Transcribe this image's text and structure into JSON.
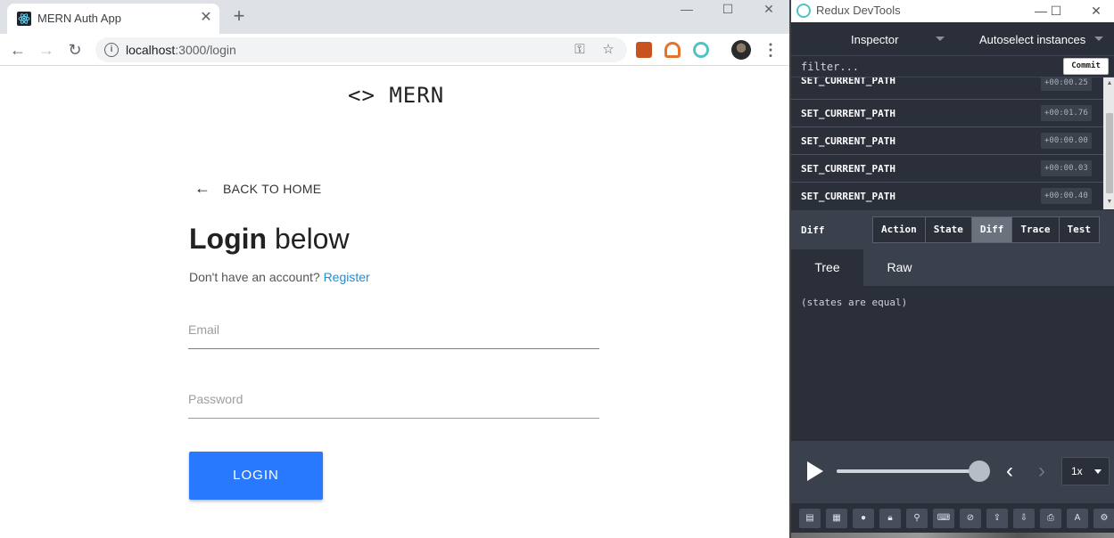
{
  "browser": {
    "tab_title": "MERN Auth App",
    "url_host": "localhost",
    "url_rest": ":3000/login",
    "window_controls": [
      "minimize-icon",
      "maximize-icon",
      "close-icon"
    ]
  },
  "page": {
    "brand": "<> MERN",
    "back_label": "BACK TO HOME",
    "heading_bold": "Login",
    "heading_rest": "below",
    "subtitle": "Don't have an account?",
    "register_link": "Register",
    "email_label": "Email",
    "password_label": "Password",
    "login_button": "LOGIN",
    "colors": {
      "primary_button": "#2979ff",
      "link": "#1f8fd6",
      "field_focus": "#26a69a"
    }
  },
  "devtools": {
    "window_title": "Redux DevTools",
    "monitor": "Inspector",
    "instance_select": "Autoselect instances",
    "filter_placeholder": "filter...",
    "commit_label": "Commit",
    "actions": [
      {
        "name": "SET_CURRENT_PATH",
        "time": "+00:00.25"
      },
      {
        "name": "SET_CURRENT_PATH",
        "time": "+00:01.76"
      },
      {
        "name": "SET_CURRENT_PATH",
        "time": "+00:00.00"
      },
      {
        "name": "SET_CURRENT_PATH",
        "time": "+00:00.03"
      },
      {
        "name": "SET_CURRENT_PATH",
        "time": "+00:00.40"
      }
    ],
    "panel_label": "Diff",
    "tabs": [
      "Action",
      "State",
      "Diff",
      "Trace",
      "Test"
    ],
    "active_tab": "Diff",
    "subtabs": [
      "Tree",
      "Raw"
    ],
    "active_subtab": "Tree",
    "diff_message": "(states are equal)",
    "slider_position": 1.0,
    "speed": "1x",
    "footer_icons": [
      "dock-left-icon",
      "dock-right-icon",
      "record-icon",
      "lock-icon",
      "pin-icon",
      "keyboard-icon",
      "persist-icon",
      "import-icon",
      "export-icon",
      "print-icon",
      "remote-icon",
      "settings-icon"
    ]
  }
}
